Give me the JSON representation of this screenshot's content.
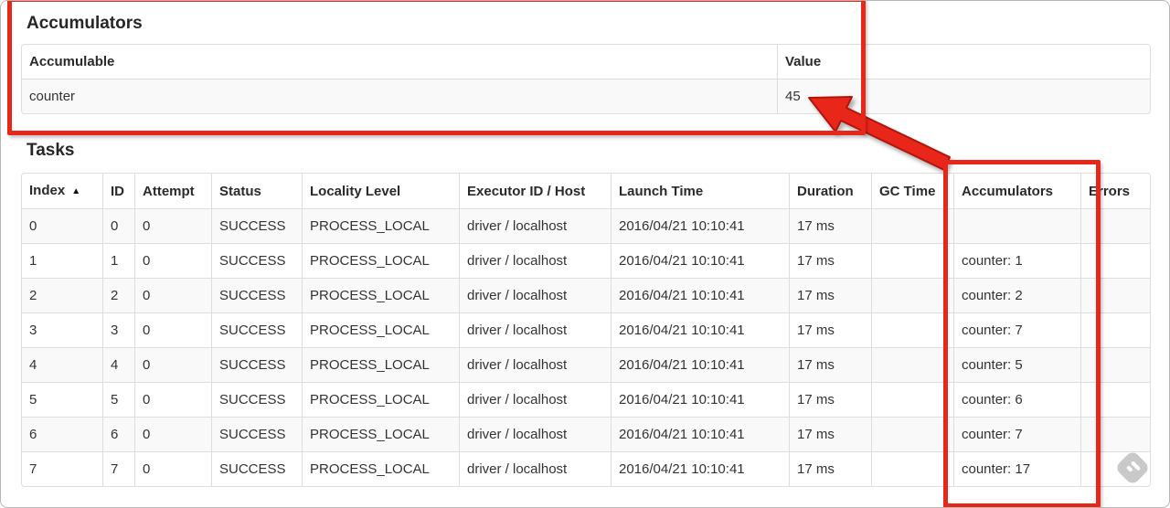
{
  "annotation": {
    "highlight_color": "#e8261a"
  },
  "accumulators_section": {
    "heading": "Accumulators",
    "table": {
      "columns": [
        "Accumulable",
        "Value"
      ],
      "rows": [
        [
          "counter",
          "45"
        ]
      ]
    }
  },
  "tasks_section": {
    "heading": "Tasks",
    "table": {
      "sort_icon": "▲",
      "columns": [
        "Index",
        "ID",
        "Attempt",
        "Status",
        "Locality Level",
        "Executor ID / Host",
        "Launch Time",
        "Duration",
        "GC Time",
        "Accumulators",
        "Errors"
      ],
      "rows": [
        [
          "0",
          "0",
          "0",
          "SUCCESS",
          "PROCESS_LOCAL",
          "driver / localhost",
          "2016/04/21 10:10:41",
          "17 ms",
          "",
          "",
          ""
        ],
        [
          "1",
          "1",
          "0",
          "SUCCESS",
          "PROCESS_LOCAL",
          "driver / localhost",
          "2016/04/21 10:10:41",
          "17 ms",
          "",
          "counter: 1",
          ""
        ],
        [
          "2",
          "2",
          "0",
          "SUCCESS",
          "PROCESS_LOCAL",
          "driver / localhost",
          "2016/04/21 10:10:41",
          "17 ms",
          "",
          "counter: 2",
          ""
        ],
        [
          "3",
          "3",
          "0",
          "SUCCESS",
          "PROCESS_LOCAL",
          "driver / localhost",
          "2016/04/21 10:10:41",
          "17 ms",
          "",
          "counter: 7",
          ""
        ],
        [
          "4",
          "4",
          "0",
          "SUCCESS",
          "PROCESS_LOCAL",
          "driver / localhost",
          "2016/04/21 10:10:41",
          "17 ms",
          "",
          "counter: 5",
          ""
        ],
        [
          "5",
          "5",
          "0",
          "SUCCESS",
          "PROCESS_LOCAL",
          "driver / localhost",
          "2016/04/21 10:10:41",
          "17 ms",
          "",
          "counter: 6",
          ""
        ],
        [
          "6",
          "6",
          "0",
          "SUCCESS",
          "PROCESS_LOCAL",
          "driver / localhost",
          "2016/04/21 10:10:41",
          "17 ms",
          "",
          "counter: 7",
          ""
        ],
        [
          "7",
          "7",
          "0",
          "SUCCESS",
          "PROCESS_LOCAL",
          "driver / localhost",
          "2016/04/21 10:10:41",
          "17 ms",
          "",
          "counter: 17",
          ""
        ]
      ]
    }
  }
}
